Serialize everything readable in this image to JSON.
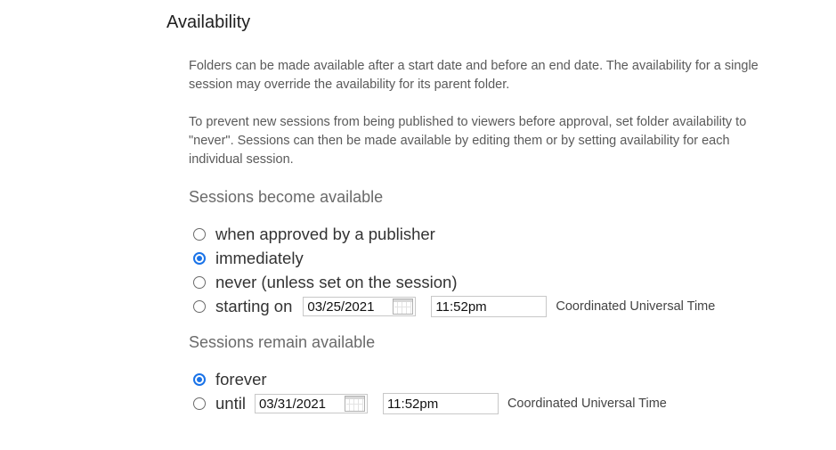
{
  "title": "Availability",
  "description": [
    "Folders can be made available after a start date and before an end date. The availability for a single session may override the availability for its parent folder.",
    "To prevent new sessions from being published to viewers before approval, set folder availability to \"never\". Sessions can then be made available by editing them or by setting availability for each individual session."
  ],
  "become_available": {
    "heading": "Sessions become available",
    "options": [
      {
        "label": "when approved by a publisher",
        "checked": false
      },
      {
        "label": "immediately",
        "checked": true
      },
      {
        "label": "never (unless set on the session)",
        "checked": false
      },
      {
        "label": "starting on",
        "checked": false
      }
    ],
    "start_date": "03/25/2021",
    "start_time": "11:52pm",
    "timezone": "Coordinated Universal Time"
  },
  "remain_available": {
    "heading": "Sessions remain available",
    "options": [
      {
        "label": "forever",
        "checked": true
      },
      {
        "label": "until",
        "checked": false
      }
    ],
    "end_date": "03/31/2021",
    "end_time": "11:52pm",
    "timezone": "Coordinated Universal Time"
  },
  "icons": {
    "calendar": "calendar-icon"
  },
  "colors": {
    "accent": "#1a73e8"
  }
}
